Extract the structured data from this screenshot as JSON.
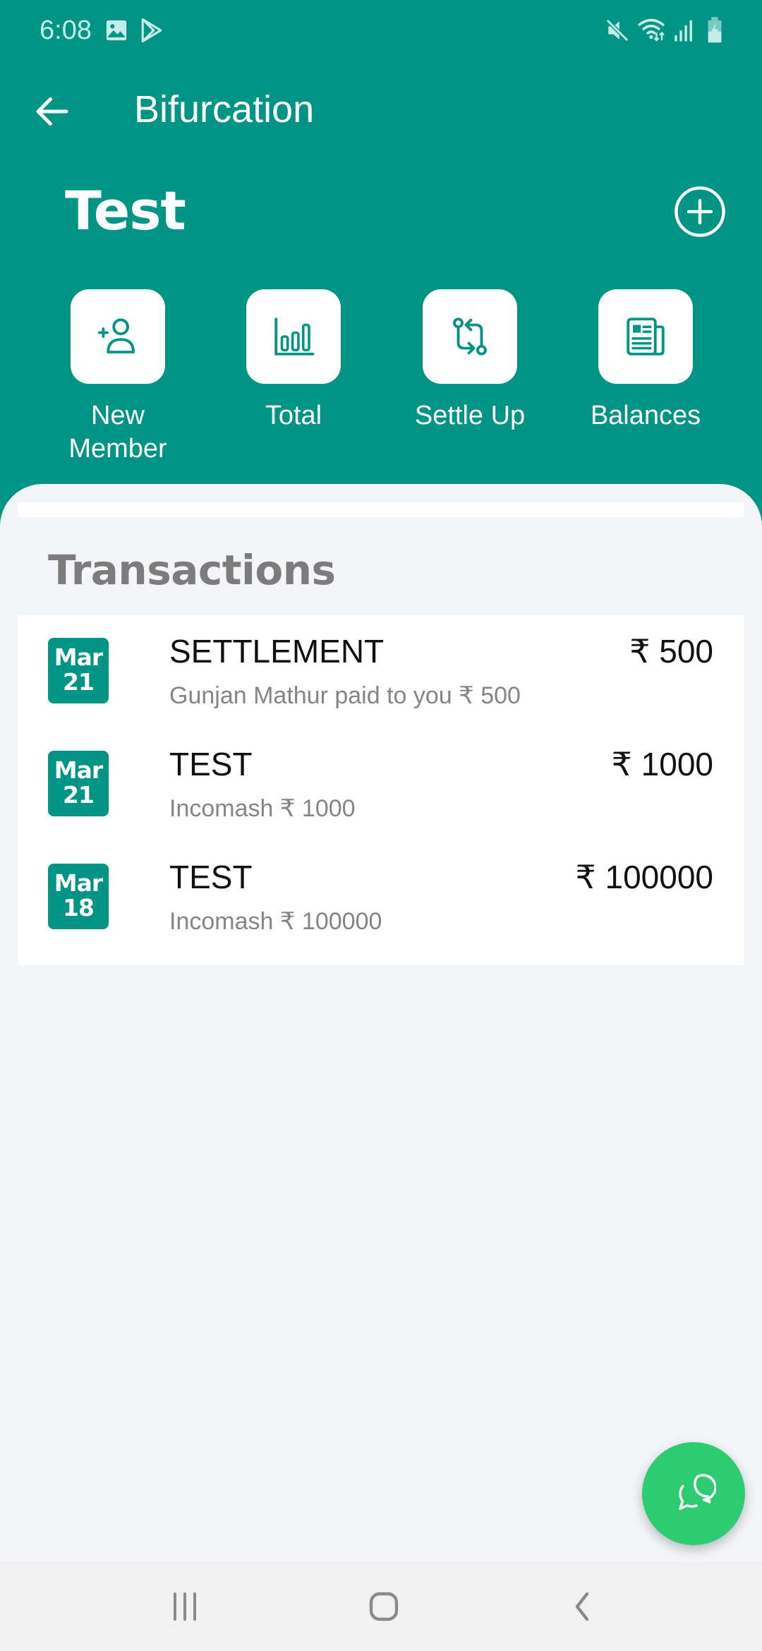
{
  "status_bar": {
    "time": "6:08",
    "left_icons": [
      "image-icon",
      "play-store-icon"
    ],
    "right_icons": [
      "mute-icon",
      "wifi-icon",
      "signal-icon",
      "battery-charging-icon"
    ]
  },
  "app_bar": {
    "back_icon": "arrow-left-icon",
    "title": "Bifurcation"
  },
  "group": {
    "name": "Test",
    "add_icon": "plus-circle-icon"
  },
  "actions": [
    {
      "label": "New Member",
      "icon": "add-user-icon"
    },
    {
      "label": "Total",
      "icon": "bar-chart-icon"
    },
    {
      "label": "Settle Up",
      "icon": "swap-icon"
    },
    {
      "label": "Balances",
      "icon": "newspaper-icon"
    }
  ],
  "transactions": {
    "title": "Transactions",
    "items": [
      {
        "month": "Mar",
        "day": "21",
        "title": "SETTLEMENT",
        "subtitle": "Gunjan Mathur paid to you ₹ 500",
        "amount": "₹ 500"
      },
      {
        "month": "Mar",
        "day": "21",
        "title": "TEST",
        "subtitle": "Incomash ₹ 1000",
        "amount": "₹ 1000"
      },
      {
        "month": "Mar",
        "day": "18",
        "title": "TEST",
        "subtitle": "Incomash ₹ 100000",
        "amount": "₹ 100000"
      }
    ]
  },
  "fab": {
    "icon": "chat-icon"
  },
  "nav_bar": {
    "buttons": [
      "recent-apps",
      "home",
      "back"
    ]
  },
  "colors": {
    "primary": "#009485",
    "fab": "#2ecc71",
    "background": "#f3f5f9"
  }
}
